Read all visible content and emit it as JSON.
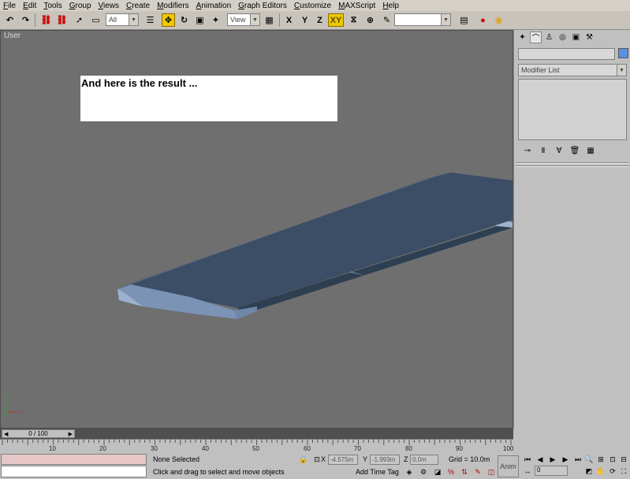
{
  "menu": [
    "File",
    "Edit",
    "Tools",
    "Group",
    "Views",
    "Create",
    "Modifiers",
    "Animation",
    "Graph Editors",
    "Customize",
    "MAXScript",
    "Help"
  ],
  "toolbar": {
    "selection_filter": "All",
    "ref_coord": "View",
    "named_selection": "",
    "axis_x": "X",
    "axis_y": "Y",
    "axis_z": "Z",
    "axis_xy": "XY"
  },
  "viewport": {
    "label": "User",
    "note": "And here is the result ...",
    "background": "#6f6f6f",
    "wing_color": "#3a4d63"
  },
  "command_panel": {
    "modifier_list": "Modifier List",
    "object_color": "#5b8fe0"
  },
  "timeline": {
    "frame_display": "0 / 100",
    "ticks": [
      "10",
      "20",
      "30",
      "40",
      "50",
      "60",
      "70",
      "80",
      "90",
      "100"
    ]
  },
  "status": {
    "selection": "None Selected",
    "prompt": "Click and drag to select and move objects",
    "x_label": "X",
    "x_value": "-4.575m",
    "y_label": "Y",
    "y_value": "-1.993m",
    "z_label": "Z",
    "z_value": "0.0m",
    "grid": "Grid = 10.0m",
    "add_time_tag": "Add Time Tag",
    "anim_button": "Anim",
    "frame": "0"
  }
}
